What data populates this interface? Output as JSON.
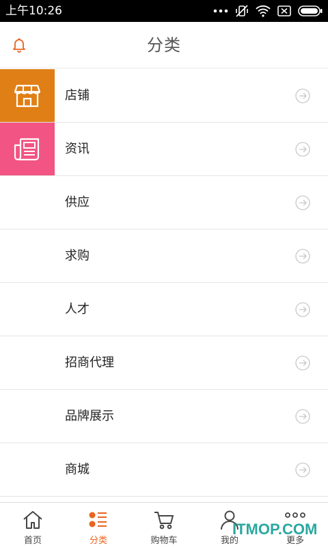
{
  "status_bar": {
    "time": "上午10:26"
  },
  "header": {
    "title": "分类",
    "left_icon": "bell-icon"
  },
  "colors": {
    "accent": "#e8641e",
    "shop_tile": "#e07f16",
    "news_tile": "#f25483"
  },
  "categories": [
    {
      "label": "店铺",
      "icon": "storefront-icon"
    },
    {
      "label": "资讯",
      "icon": "newspaper-icon"
    },
    {
      "label": "供应"
    },
    {
      "label": "求购"
    },
    {
      "label": "人才"
    },
    {
      "label": "招商代理"
    },
    {
      "label": "品牌展示"
    },
    {
      "label": "商城"
    }
  ],
  "bottom_nav": {
    "items": [
      {
        "label": "首页",
        "icon": "home-icon"
      },
      {
        "label": "分类",
        "icon": "category-list-icon",
        "active": true
      },
      {
        "label": "购物车",
        "icon": "cart-icon"
      },
      {
        "label": "我的",
        "icon": "user-icon"
      },
      {
        "label": "更多",
        "icon": "more-dots-icon"
      }
    ]
  },
  "watermark": "ITMOP.COM"
}
